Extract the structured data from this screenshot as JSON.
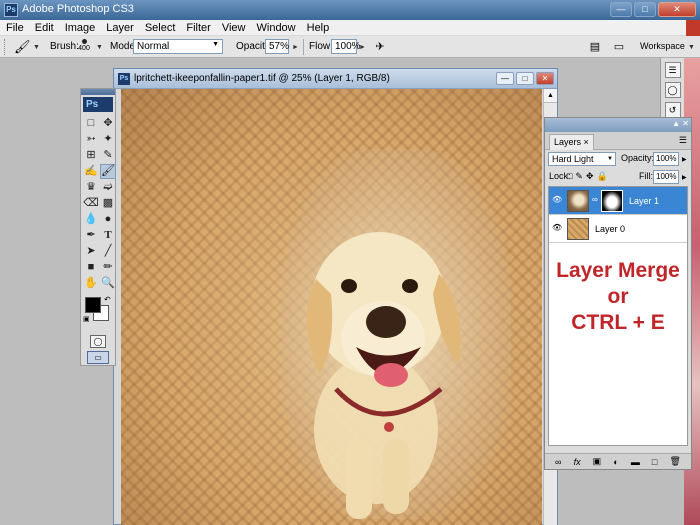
{
  "app": {
    "title": "Adobe Photoshop CS3",
    "logo": "Ps"
  },
  "menu": [
    "File",
    "Edit",
    "Image",
    "Layer",
    "Select",
    "Filter",
    "View",
    "Window",
    "Help"
  ],
  "options": {
    "brush_label": "Brush:",
    "brush_size": "400",
    "mode_label": "Mode:",
    "mode_value": "Normal",
    "opacity_label": "Opacity:",
    "opacity_value": "57%",
    "flow_label": "Flow:",
    "flow_value": "100%",
    "workspace_label": "Workspace"
  },
  "document": {
    "title": "lpritchett-ikeeponfallin-paper1.tif @ 25% (Layer 1, RGB/8)"
  },
  "layers_panel": {
    "tab": "Layers",
    "blend_mode": "Hard Light",
    "opacity_label": "Opacity:",
    "opacity_value": "100%",
    "lock_label": "Lock:",
    "fill_label": "Fill:",
    "fill_value": "100%",
    "layers": [
      {
        "name": "Layer 1",
        "selected": true
      },
      {
        "name": "Layer 0",
        "selected": false
      }
    ]
  },
  "annotation": {
    "line1": "Layer Merge",
    "line2": "or",
    "line3": "CTRL + E"
  },
  "colors": {
    "accent_blue": "#3b86d4",
    "annotation_red": "#c0252a",
    "foreground": "#000000",
    "background": "#ffffff"
  },
  "icons": {
    "toolbar_tool": "brush-icon",
    "airbrush": "airbrush-icon",
    "palette": "palette-icon"
  }
}
